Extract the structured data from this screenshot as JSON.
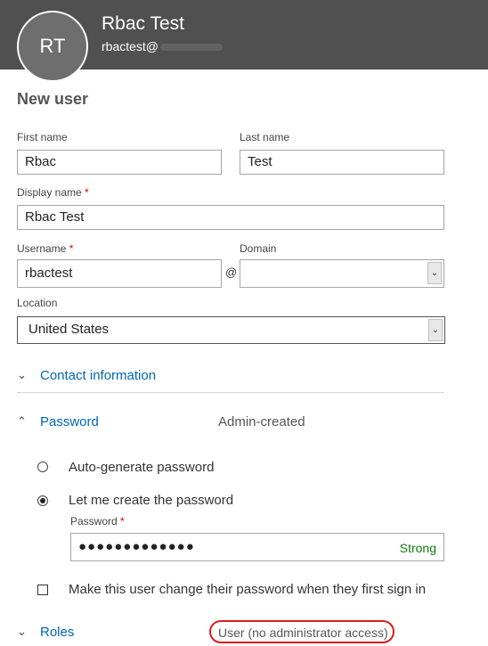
{
  "header": {
    "avatar_initials": "RT",
    "user_name": "Rbac Test",
    "user_email": "rbactest@"
  },
  "page_title": "New user",
  "form": {
    "first_name": {
      "label": "First name",
      "value": "Rbac"
    },
    "last_name": {
      "label": "Last name",
      "value": "Test"
    },
    "display_name": {
      "label": "Display name",
      "required_mark": "*",
      "value": "Rbac Test"
    },
    "username": {
      "label": "Username",
      "required_mark": "*",
      "value": "rbactest"
    },
    "at_symbol": "@",
    "domain": {
      "label": "Domain",
      "value": ""
    },
    "location": {
      "label": "Location",
      "value": "United States"
    }
  },
  "sections": {
    "contact": {
      "label": "Contact information",
      "icon": "chevron-down-icon"
    },
    "password": {
      "label": "Password",
      "value": "Admin-created",
      "icon": "chevron-up-icon"
    },
    "roles": {
      "label": "Roles",
      "value": "User (no administrator access)",
      "icon": "chevron-down-icon"
    }
  },
  "password_options": {
    "auto_generate": {
      "label": "Auto-generate password",
      "checked": false
    },
    "create": {
      "label": "Let me create the password",
      "checked": true
    }
  },
  "password_field": {
    "label": "Password",
    "required_mark": "*",
    "masked_value": "●●●●●●●●●●●●●",
    "strength": "Strong"
  },
  "change_password_checkbox": {
    "label": "Make this user change their password when they first sign in",
    "checked": false
  },
  "colors": {
    "header_bg": "#505050",
    "link": "#0067b8",
    "strength_green": "#107c10",
    "annotation_red": "#d81e1e"
  }
}
